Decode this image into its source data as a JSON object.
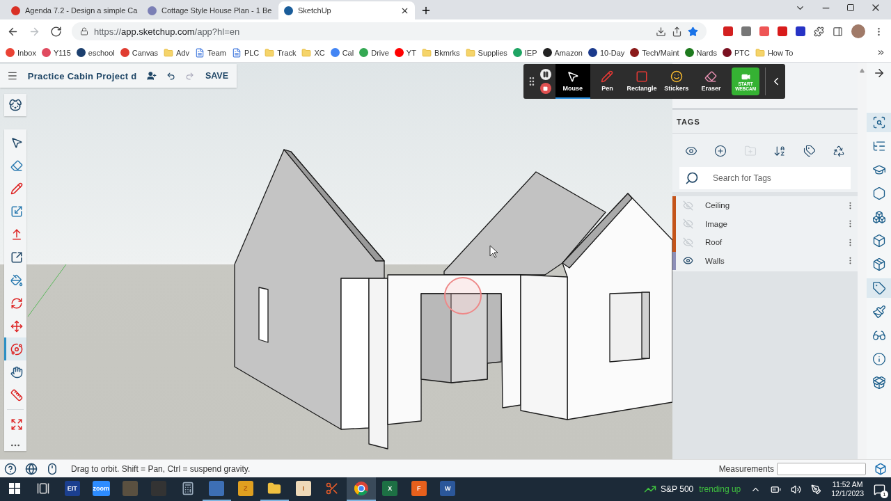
{
  "browser_tabs": [
    {
      "title": "Agenda 7.2 - Design a simple Ca",
      "color": "#d93025",
      "selected": false
    },
    {
      "title": "Cottage Style House Plan - 1 Be",
      "color": "#7b7fb5",
      "selected": false
    },
    {
      "title": "SketchUp",
      "color": "#1a5d9a",
      "selected": true
    }
  ],
  "navigation": [
    {
      "kind": "back",
      "disabled": false
    },
    {
      "kind": "forward",
      "disabled": true
    },
    {
      "kind": "reload",
      "disabled": false
    }
  ],
  "address": {
    "scheme": "https://",
    "host": "app.sketchup.com",
    "path": "/app?hl=en",
    "bookmarked": true
  },
  "bookmarks": [
    {
      "label": "Inbox",
      "kind": "site",
      "color": "#ea4335"
    },
    {
      "label": "Y115",
      "kind": "site",
      "color": "#e04a5f"
    },
    {
      "label": "eschool",
      "kind": "site",
      "color": "#1c3f6e"
    },
    {
      "label": "Canvas",
      "kind": "site",
      "color": "#e03c31"
    },
    {
      "label": "Adv",
      "kind": "folder"
    },
    {
      "label": "Team",
      "kind": "doc"
    },
    {
      "label": "PLC",
      "kind": "doc"
    },
    {
      "label": "Track",
      "kind": "folder"
    },
    {
      "label": "XC",
      "kind": "folder"
    },
    {
      "label": "Cal",
      "kind": "site",
      "color": "#4285f4"
    },
    {
      "label": "Drive",
      "kind": "site",
      "color": "#34a853"
    },
    {
      "label": "YT",
      "kind": "site",
      "color": "#ff0000"
    },
    {
      "label": "Bkmrks",
      "kind": "folder"
    },
    {
      "label": "Supplies",
      "kind": "folder"
    },
    {
      "label": "IEP",
      "kind": "site",
      "color": "#1fa463"
    },
    {
      "label": "Amazon",
      "kind": "site",
      "color": "#222222"
    },
    {
      "label": "10-Day",
      "kind": "site",
      "color": "#1b3a8c"
    },
    {
      "label": "Tech/Maint",
      "kind": "site",
      "color": "#8b1a1a"
    },
    {
      "label": "Nards",
      "kind": "site",
      "color": "#1e7a1e"
    },
    {
      "label": "PTC",
      "kind": "site",
      "color": "#7a1020"
    },
    {
      "label": "How To",
      "kind": "folder"
    }
  ],
  "document": {
    "title": "Practice Cabin Project d",
    "save_label": "SAVE"
  },
  "tools": [
    {
      "kind": "pointer",
      "selected": false
    },
    {
      "kind": "eraser",
      "selected": false
    },
    {
      "kind": "pencil",
      "selected": false
    },
    {
      "kind": "scale",
      "selected": false
    },
    {
      "kind": "pushpull",
      "selected": false
    },
    {
      "kind": "offset",
      "selected": false
    },
    {
      "kind": "bucket",
      "selected": false
    },
    {
      "kind": "rotate",
      "selected": false
    },
    {
      "kind": "move",
      "selected": false
    },
    {
      "kind": "orbit",
      "selected": true
    },
    {
      "kind": "hand",
      "selected": false
    },
    {
      "kind": "ruler",
      "selected": false
    },
    {
      "kind": "expand",
      "selected": false
    }
  ],
  "recorder": {
    "tools": [
      {
        "label": "Mouse",
        "kind": "pointer",
        "selected": true
      },
      {
        "label": "Pen",
        "kind": "pen",
        "selected": false
      },
      {
        "label": "Rectangle",
        "kind": "rectangle",
        "selected": false
      },
      {
        "label": "Stickers",
        "kind": "sticker",
        "selected": false
      },
      {
        "label": "Eraser",
        "kind": "eraser",
        "selected": false
      }
    ],
    "webcam_label": "START WEBCAM"
  },
  "tags_panel": {
    "title": "TAGS",
    "actions": [
      {
        "kind": "visibility",
        "disabled": false
      },
      {
        "kind": "add",
        "disabled": false
      },
      {
        "kind": "folder",
        "disabled": true
      },
      {
        "kind": "sort",
        "disabled": false
      },
      {
        "kind": "tags",
        "disabled": false
      },
      {
        "kind": "purge",
        "disabled": false
      }
    ],
    "search": {
      "placeholder": "Search for Tags"
    },
    "tags": [
      {
        "name": "Ceiling",
        "color": "#c4541a",
        "visible": false
      },
      {
        "name": "Image",
        "color": "#c4541a",
        "visible": false
      },
      {
        "name": "Roof",
        "color": "#c4541a",
        "visible": false
      },
      {
        "name": "Walls",
        "color": "#8d8fb8",
        "visible": true
      }
    ]
  },
  "side_icons": [
    {
      "kind": "inspect",
      "selected": true
    },
    {
      "kind": "outline",
      "selected": false
    },
    {
      "kind": "learn",
      "selected": false
    },
    {
      "kind": "hexagon",
      "selected": false
    },
    {
      "kind": "components",
      "selected": false
    },
    {
      "kind": "materials",
      "selected": false
    },
    {
      "kind": "package",
      "selected": false
    },
    {
      "kind": "tag",
      "selected": true
    },
    {
      "kind": "brush",
      "selected": false
    },
    {
      "kind": "glasses",
      "selected": false
    },
    {
      "kind": "info",
      "selected": false
    },
    {
      "kind": "box",
      "selected": false
    }
  ],
  "status_bar": {
    "hint": "Drag to orbit. Shift = Pan, Ctrl = suspend gravity.",
    "measurements_label": "Measurements"
  },
  "taskbar": {
    "apps": [
      {
        "kind": "start",
        "open": false,
        "selected": false
      },
      {
        "kind": "taskview",
        "open": false,
        "selected": false
      },
      {
        "kind": "tile",
        "label": "EIT",
        "color": "#1b3f8f",
        "open": false,
        "selected": false
      },
      {
        "kind": "tile",
        "label": "zoom",
        "color": "#2d8cff",
        "open": false,
        "selected": false
      },
      {
        "kind": "tile",
        "color": "#5a5040",
        "open": false,
        "selected": false
      },
      {
        "kind": "tile",
        "color": "#333333",
        "open": false,
        "selected": false
      },
      {
        "kind": "calculator",
        "open": false,
        "selected": false
      },
      {
        "kind": "tile",
        "color": "#3d6fb5",
        "open": true,
        "selected": false
      },
      {
        "kind": "tile",
        "label": "Z",
        "color": "#e0a020",
        "open": false,
        "selected": false
      },
      {
        "kind": "folder",
        "open": true,
        "selected": false
      },
      {
        "kind": "tile",
        "label": "I",
        "color": "#eed9b8",
        "open": false,
        "selected": false
      },
      {
        "kind": "scissors",
        "open": false,
        "selected": false
      },
      {
        "kind": "browser",
        "open": true,
        "selected": true
      },
      {
        "kind": "tile",
        "label": "X",
        "color": "#1d7044",
        "open": false,
        "selected": false
      },
      {
        "kind": "tile",
        "label": "F",
        "color": "#e8601c",
        "open": false,
        "selected": false
      },
      {
        "kind": "tile",
        "label": "W",
        "color": "#2b579a",
        "open": false,
        "selected": false
      }
    ],
    "ticker": {
      "name": "S&P 500",
      "trend": "trending up"
    },
    "time": "11:52 AM",
    "date": "12/1/2023",
    "notifications": "1"
  }
}
